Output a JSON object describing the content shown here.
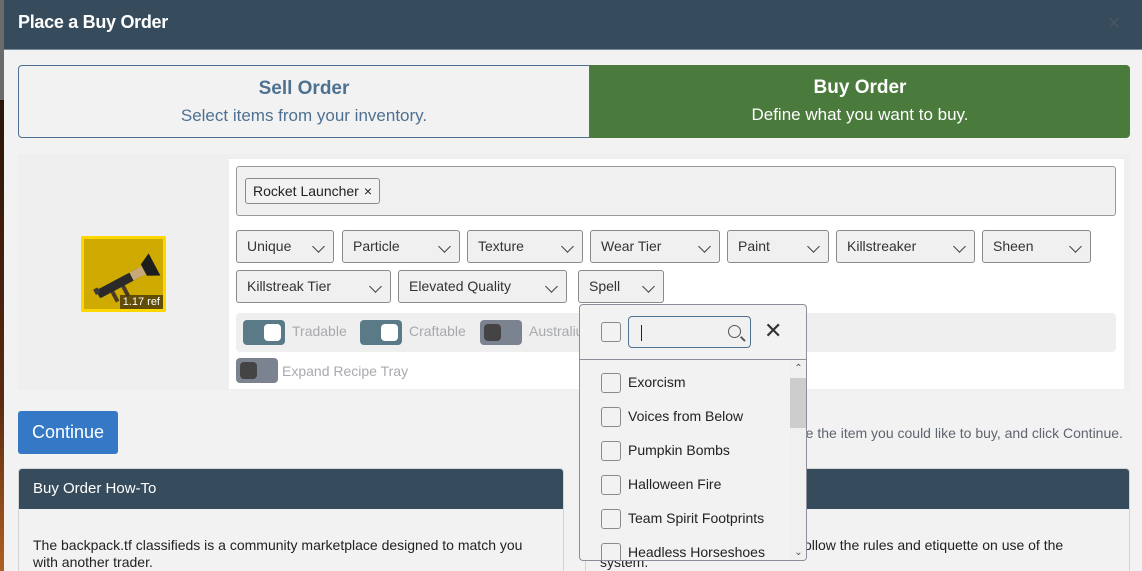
{
  "modal": {
    "title": "Place a Buy Order",
    "close_icon": "close-icon"
  },
  "order_tabs": [
    {
      "title": "Sell Order",
      "subtitle": "Select items from your inventory.",
      "active": false
    },
    {
      "title": "Buy Order",
      "subtitle": "Define what you want to buy.",
      "active": true
    }
  ],
  "item": {
    "name": "Rocket Launcher",
    "price": "1.17 ref",
    "icon": "rocket-launcher-icon"
  },
  "item_tag": {
    "label": "Rocket Launcher",
    "remove_glyph": "×"
  },
  "filters": [
    {
      "label": "Unique"
    },
    {
      "label": "Particle"
    },
    {
      "label": "Texture"
    },
    {
      "label": "Wear Tier"
    },
    {
      "label": "Paint"
    },
    {
      "label": "Killstreaker"
    },
    {
      "label": "Sheen"
    },
    {
      "label": "Killstreak Tier"
    },
    {
      "label": "Elevated Quality"
    },
    {
      "label": "Spell"
    }
  ],
  "toggles": [
    {
      "label": "Tradable",
      "on": true
    },
    {
      "label": "Craftable",
      "on": true
    },
    {
      "label": "Australium",
      "on": false
    },
    {
      "label": "Expand Recipe Tray",
      "on": false
    }
  ],
  "spell_menu": {
    "search_value": "",
    "close_glyph": "✕",
    "options": [
      {
        "label": "Exorcism",
        "checked": false
      },
      {
        "label": "Voices from Below",
        "checked": false
      },
      {
        "label": "Pumpkin Bombs",
        "checked": false
      },
      {
        "label": "Halloween Fire",
        "checked": false
      },
      {
        "label": "Team Spirit Footprints",
        "checked": false
      },
      {
        "label": "Headless Horseshoes",
        "checked": false
      }
    ],
    "scroll_up_glyph": "⌃",
    "scroll_down_glyph": "⌄"
  },
  "continue_button": {
    "label": "Continue"
  },
  "instructions": "ate the item you could like to buy, and click Continue.",
  "cards": [
    {
      "title": "Buy Order How-To",
      "body": "The backpack.tf classifieds is a community marketplace designed to match you with another trader."
    },
    {
      "title": "",
      "body": "ollow the rules and etiquette on use of the system."
    }
  ],
  "colors": {
    "header_bg": "#364c5c",
    "buy_tab_bg": "#4a7a3c",
    "sell_tab_text": "#4f7191",
    "primary_button": "#3478c6",
    "item_border": "#ffd700",
    "item_bg": "#cfaa00"
  }
}
